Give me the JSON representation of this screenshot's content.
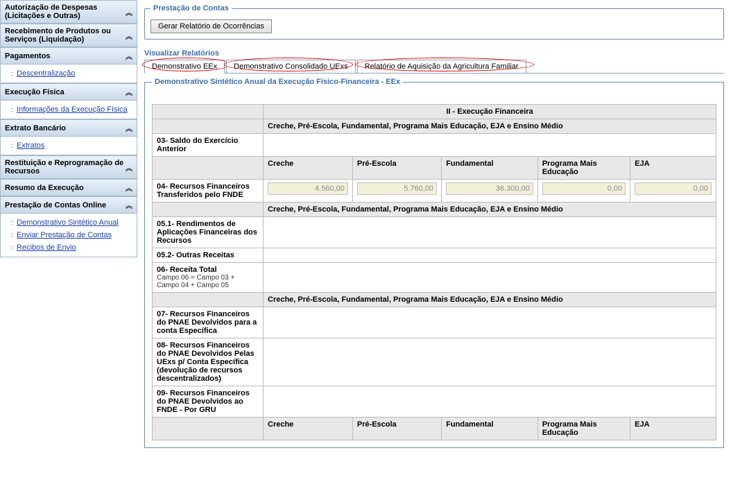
{
  "sidebar": {
    "sections": [
      {
        "title": "Autorização de Despesas (Licitações e Outras)",
        "items": []
      },
      {
        "title": "Recebimento de Produtos ou Serviços (Liquidação)",
        "items": []
      },
      {
        "title": "Pagamentos",
        "items": [
          {
            "label": "Descentralização"
          }
        ]
      },
      {
        "title": "Execução Física",
        "items": [
          {
            "label": "Informações da Execução Física"
          }
        ]
      },
      {
        "title": "Extrato Bancário",
        "items": [
          {
            "label": "Extratos"
          }
        ]
      },
      {
        "title": "Restituição e Reprogramação de Recursos",
        "items": []
      },
      {
        "title": "Resumo da Execução",
        "items": []
      },
      {
        "title": "Prestação de Contas Online",
        "items": [
          {
            "label": "Demonstrativo Sintético Anual"
          },
          {
            "label": "Enviar Prestação de Contas"
          },
          {
            "label": "Recibos de Envio"
          }
        ]
      }
    ]
  },
  "main": {
    "fieldset_title": "Prestação de Contas",
    "generate_button": "Gerar Relatório de Ocorrências",
    "visualizar_label": "Visualizar Relatórios",
    "tabs": [
      {
        "label": "Demonstrativo EEx"
      },
      {
        "label": "Demonstrativo Consolidado UExs"
      },
      {
        "label": "Relatório de Aquisição da Agricultura Familiar"
      }
    ],
    "inner_title": "Demonstrativo Sintético Anual da Execução Físico-Financeira - EEx",
    "table": {
      "section_title": "II - Execução Financeira",
      "group_header": "Creche, Pré-Escola, Fundamental, Programa Mais Educação, EJA e Ensino Médio",
      "columns": [
        "Creche",
        "Pré-Escola",
        "Fundamental",
        "Programa Mais Educação",
        "EJA"
      ],
      "rows": {
        "r03": {
          "label": "03- Saldo do Exercício Anterior"
        },
        "r04": {
          "label": "04- Recursos Financeiros Transferidos pelo FNDE",
          "values": [
            "4.560,00",
            "5.760,00",
            "36.300,00",
            "0,00",
            "0,00"
          ]
        },
        "r051": {
          "label": "05.1- Rendimentos de Aplicações Financeiras dos Recursos"
        },
        "r052": {
          "label": "05.2- Outras Receitas"
        },
        "r06": {
          "label": "06- Receita Total",
          "sub": "Campo 06 = Campo 03 + Campo 04 + Campo 05"
        },
        "r07": {
          "label": "07- Recursos Financeiros do PNAE Devolvidos para a conta Específica"
        },
        "r08": {
          "label": "08- Recursos Financeiros do PNAE Devolvidos Pelas UExs p/ Conta Específica (devolução de recursos descentralizados)"
        },
        "r09": {
          "label": "09- Recursos Financeiros do PNAE Devolvidos ao FNDE - Por GRU"
        }
      }
    }
  }
}
